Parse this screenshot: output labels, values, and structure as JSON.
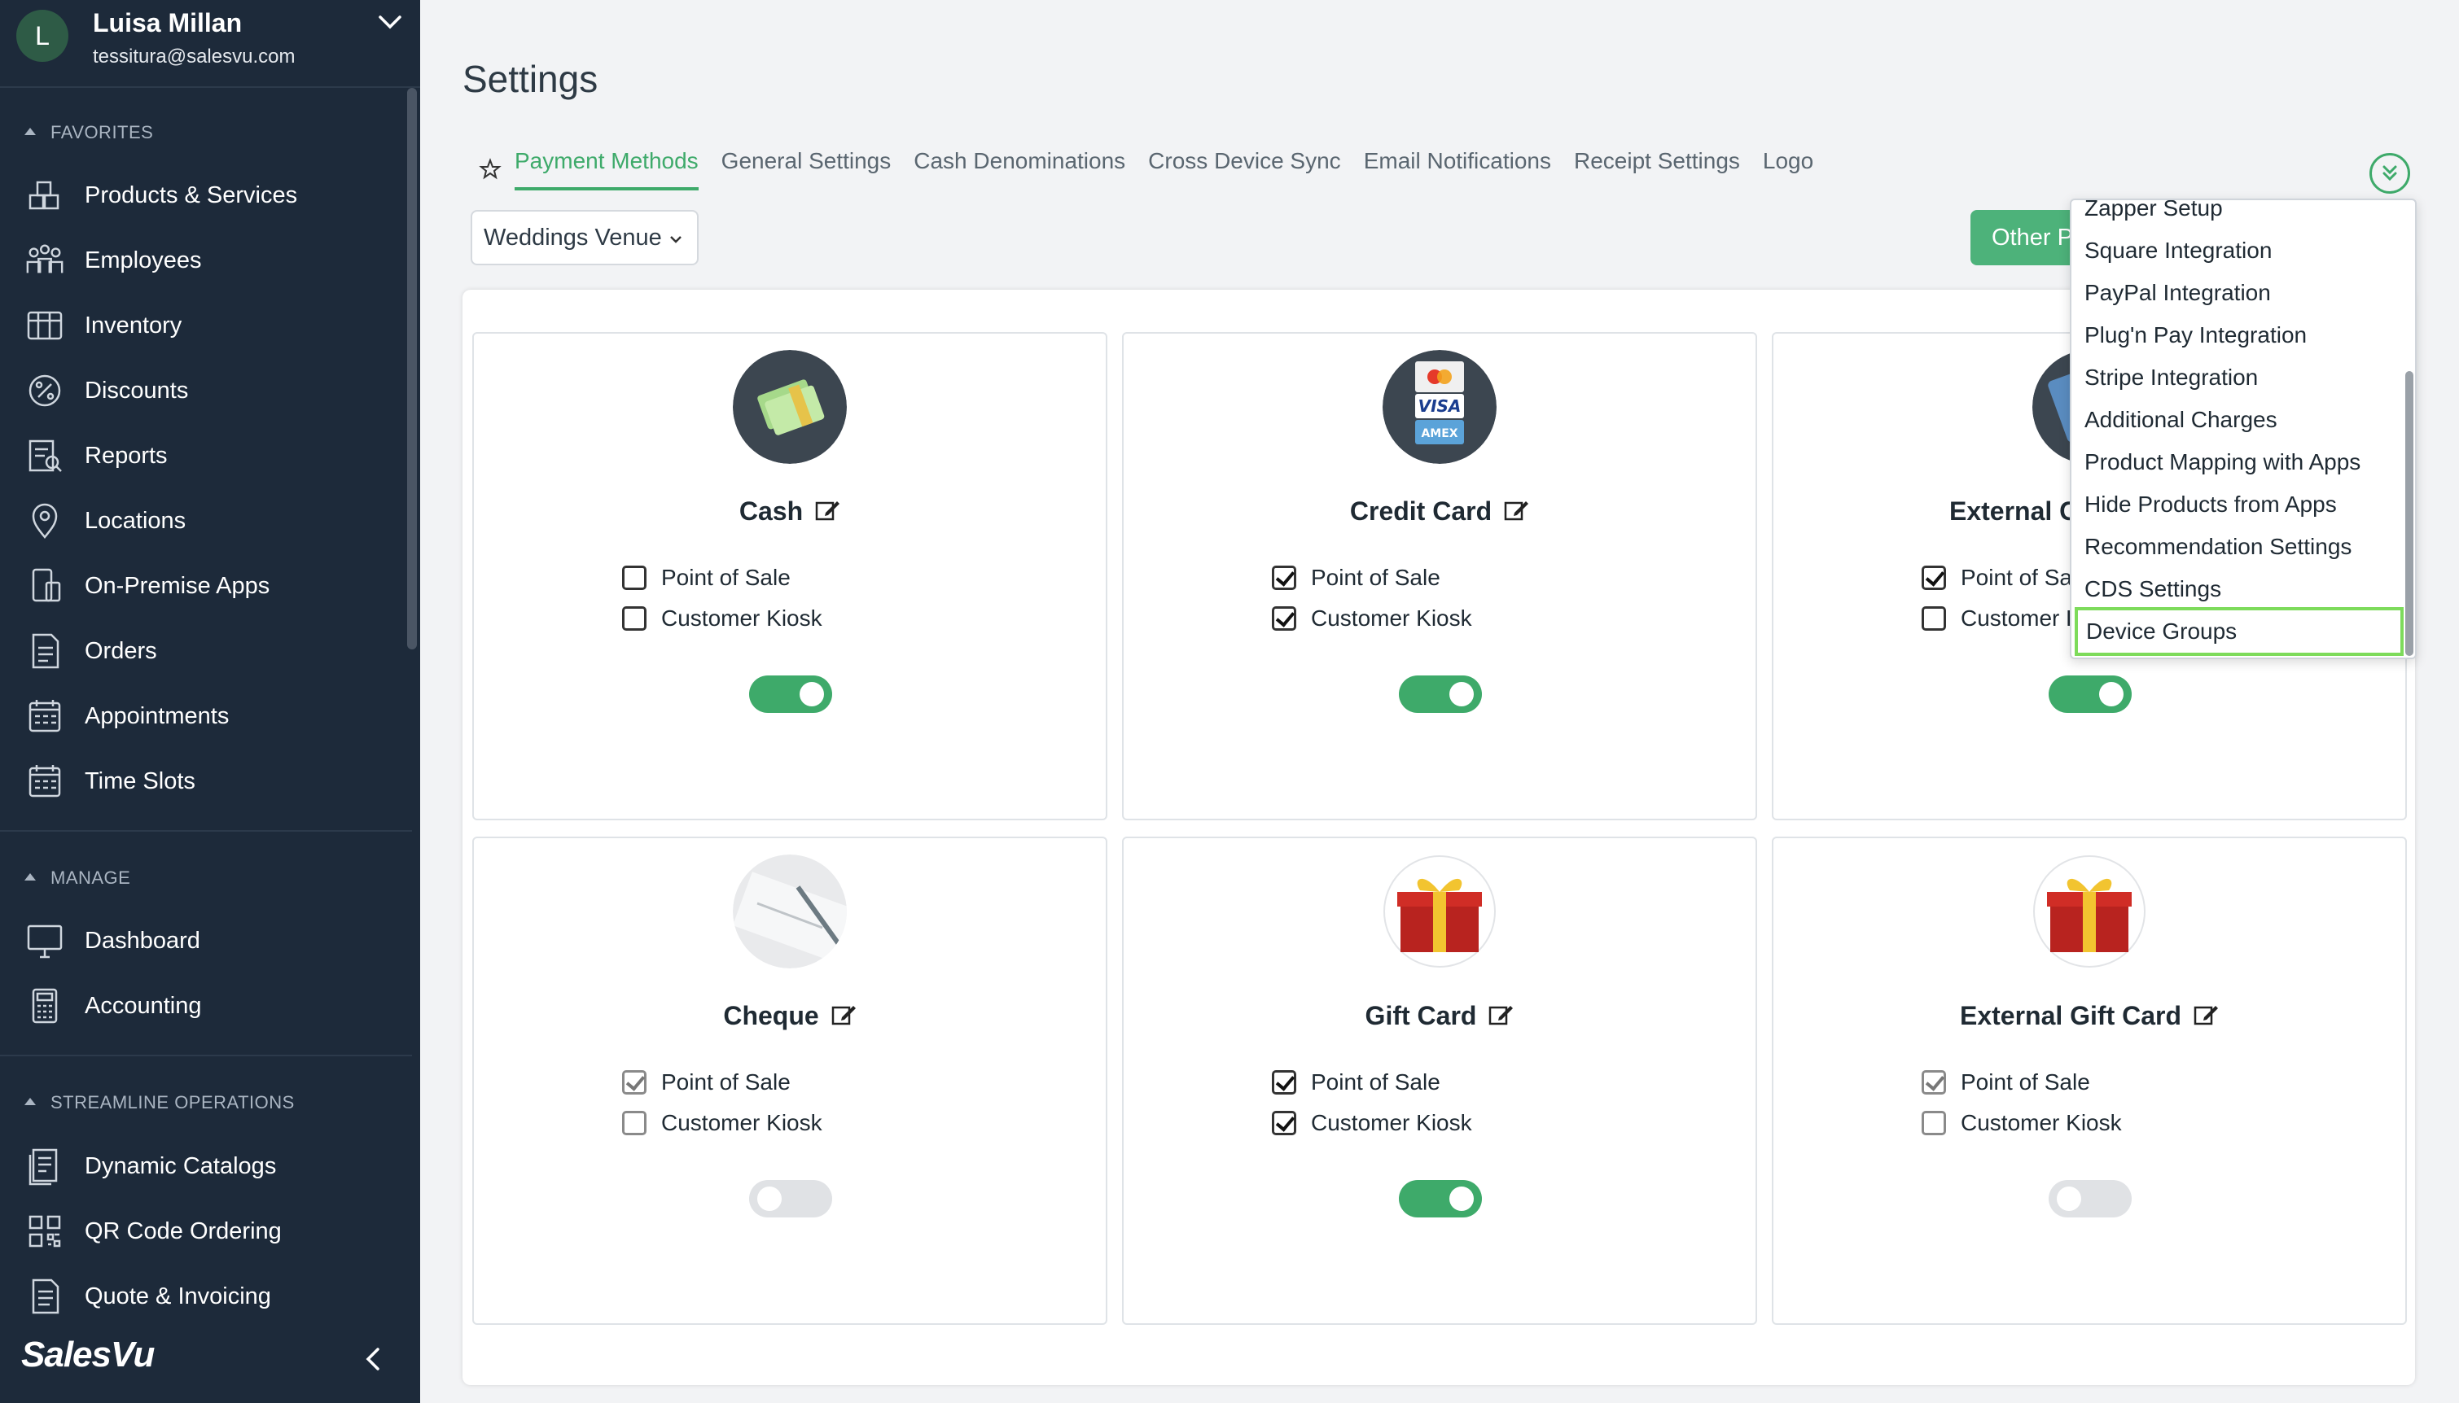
{
  "user": {
    "initial": "L",
    "name": "Luisa Millan",
    "email": "tessitura@salesvu.com"
  },
  "sidebar": {
    "favorites_label": "FAVORITES",
    "favorites": [
      {
        "label": "Products & Services",
        "icon": "boxes-icon"
      },
      {
        "label": "Employees",
        "icon": "people-icon"
      },
      {
        "label": "Inventory",
        "icon": "inventory-icon"
      },
      {
        "label": "Discounts",
        "icon": "percent-icon"
      },
      {
        "label": "Reports",
        "icon": "report-icon"
      },
      {
        "label": "Locations",
        "icon": "location-pin-icon"
      },
      {
        "label": "On-Premise Apps",
        "icon": "apps-icon"
      },
      {
        "label": "Orders",
        "icon": "orders-icon"
      },
      {
        "label": "Appointments",
        "icon": "calendar-icon"
      },
      {
        "label": "Time Slots",
        "icon": "calendar-icon"
      }
    ],
    "manage_label": "MANAGE",
    "manage": [
      {
        "label": "Dashboard",
        "icon": "monitor-icon"
      },
      {
        "label": "Accounting",
        "icon": "calculator-icon"
      }
    ],
    "streamline_label": "STREAMLINE OPERATIONS",
    "streamline": [
      {
        "label": "Dynamic Catalogs",
        "icon": "catalog-icon"
      },
      {
        "label": "QR Code Ordering",
        "icon": "qr-code-icon"
      },
      {
        "label": "Quote & Invoicing",
        "icon": "invoice-icon"
      }
    ],
    "brand": "SalesVu"
  },
  "page": {
    "title": "Settings"
  },
  "tabs": [
    "Payment Methods",
    "General Settings",
    "Cash Denominations",
    "Cross Device Sync",
    "Email Notifications",
    "Receipt Settings",
    "Logo"
  ],
  "active_tab": "Payment Methods",
  "venue_select": {
    "value": "Weddings Venue"
  },
  "other_button": {
    "label": "Other P"
  },
  "options": {
    "pos": "Point of Sale",
    "kiosk": "Customer Kiosk"
  },
  "cards": [
    {
      "title": "Cash",
      "pos": false,
      "kiosk": false,
      "enabled": true
    },
    {
      "title": "Credit Card",
      "pos": true,
      "kiosk": true,
      "enabled": true
    },
    {
      "title": "External Cr",
      "pos_label": "Point of Sal",
      "kiosk_label": "Customer K",
      "pos": true,
      "kiosk": false,
      "enabled": true
    },
    {
      "title": "Cheque",
      "pos": true,
      "kiosk": false,
      "enabled": false
    },
    {
      "title": "Gift Card",
      "pos": true,
      "kiosk": true,
      "enabled": true
    },
    {
      "title": "External Gift Card",
      "pos": true,
      "kiosk": false,
      "enabled": false
    }
  ],
  "dropdown": {
    "items": [
      "Zapper Setup",
      "Square Integration",
      "PayPal Integration",
      "Plug'n Pay Integration",
      "Stripe Integration",
      "Additional Charges",
      "Product Mapping with Apps",
      "Hide Products from Apps",
      "Recommendation Settings",
      "CDS Settings",
      "Device Groups"
    ],
    "highlighted": "Device Groups"
  },
  "colors": {
    "sidebar": "#1d2a3a",
    "accent": "#3eaa6a",
    "highlight_border": "#7ddb5b"
  }
}
